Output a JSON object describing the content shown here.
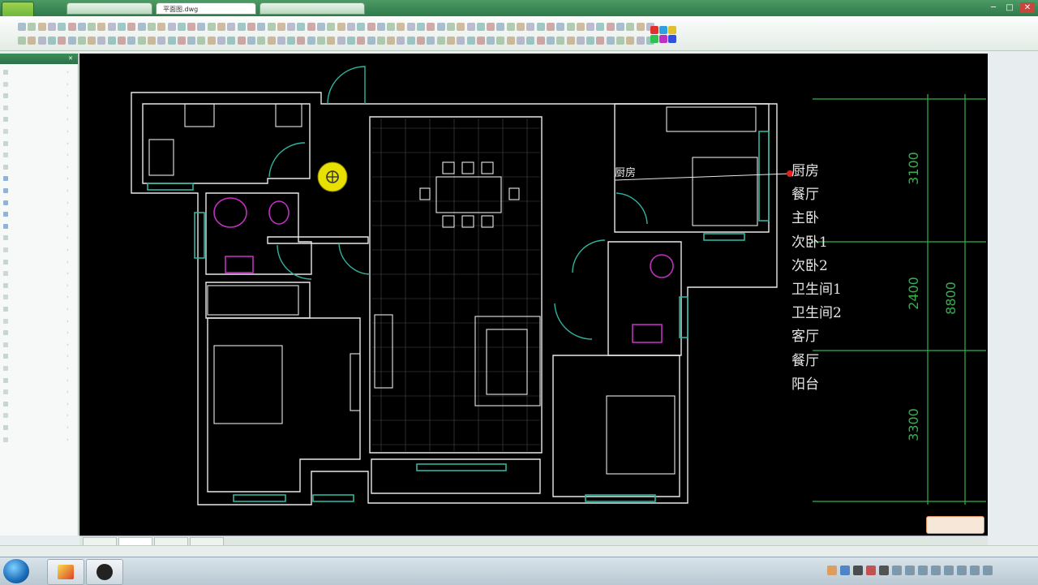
{
  "window": {
    "tabs": [
      "",
      "平面图.dwg",
      ""
    ],
    "title_tools": [
      "",
      "",
      "",
      "",
      ""
    ],
    "controls": {
      "minimize": "─",
      "maximize": "□",
      "close": "✕"
    }
  },
  "side_panel": {
    "header": "",
    "items": [
      "",
      "",
      "",
      "",
      "",
      "",
      "",
      "",
      "",
      "",
      "",
      "",
      "",
      "",
      "",
      "",
      "",
      "",
      "",
      "",
      "",
      "",
      "",
      "",
      "",
      "",
      "",
      "",
      "",
      "",
      "",
      ""
    ]
  },
  "drawing": {
    "pointer_label": "厨房",
    "room_list": [
      "厨房",
      "餐厅",
      "主卧",
      "次卧1",
      "次卧2",
      "卫生间1",
      "卫生间2",
      "客厅",
      "餐厅",
      "阳台"
    ],
    "dimensions": [
      "3100",
      "2400",
      "8800",
      "3300"
    ],
    "line_color": "#e8e8e8",
    "window_color": "#2fb3a0",
    "dim_color": "#2fb34a",
    "fixture_color": "#c030c0"
  },
  "bottom_tabs": [
    "",
    "",
    "",
    ""
  ],
  "status": {
    "coordinates": ""
  },
  "taskbar": {
    "clock": ""
  }
}
